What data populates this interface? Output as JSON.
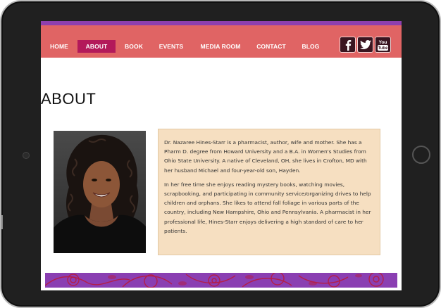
{
  "nav": {
    "items": [
      {
        "label": "HOME",
        "active": false
      },
      {
        "label": "ABOUT",
        "active": true
      },
      {
        "label": "BOOK",
        "active": false
      },
      {
        "label": "EVENTS",
        "active": false
      },
      {
        "label": "MEDIA ROOM",
        "active": false
      },
      {
        "label": "CONTACT",
        "active": false
      },
      {
        "label": "BLOG",
        "active": false
      }
    ],
    "social": [
      {
        "name": "facebook-icon",
        "glyph": "f"
      },
      {
        "name": "twitter-icon",
        "glyph": "twitter-bird"
      },
      {
        "name": "youtube-icon",
        "glyph": "You Tube"
      }
    ]
  },
  "page": {
    "title": "ABOUT"
  },
  "bio": {
    "paragraph1": "Dr. Nazaree Hines-Starr is a pharmacist, author, wife and mother. She has a Pharm D. degree from Howard University and a B.A. in Women's Studies from Ohio State University. A native of Cleveland, OH, she lives in Crofton, MD with her husband Michael and four-year-old son, Hayden.",
    "paragraph2": "In her free time she enjoys reading mystery books, watching movies, scrapbooking, and participating in community service/organizing drives to help children and orphans. She likes to attend fall foliage in various parts of the country, including New Hampshire, Ohio and Pennsylvania. A pharmacist in her professional life, Hines-Starr enjoys delivering a high standard of care to her patients."
  },
  "colors": {
    "nav_bg": "#e06464",
    "nav_active": "#b3195a",
    "top_strip": "#8e3fae",
    "bio_bg": "#f6dfc1",
    "banner_bg": "#8a3fb2",
    "banner_pattern": "#b31f4a"
  }
}
